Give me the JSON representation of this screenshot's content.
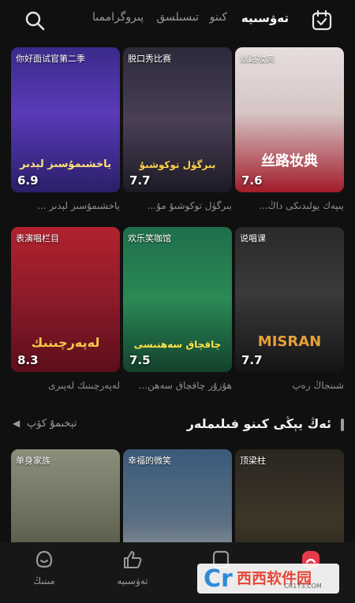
{
  "header": {
    "search_icon": "search-icon",
    "calendar_icon": "calendar-check-icon",
    "tabs": [
      {
        "label": "تەۋسىيە",
        "active": true
      },
      {
        "label": "كىنو",
        "active": false
      },
      {
        "label": "تىسىلسق",
        "active": false
      },
      {
        "label": "پىروگراممىا",
        "active": false
      }
    ]
  },
  "cards": [
    {
      "title": "你好面试官第二季",
      "score": "6.9",
      "caption": "ياخشىمۇسىز لېدىر ...",
      "art": "ياخشىمۇسىز لېدىر"
    },
    {
      "title": "脱口秀比赛",
      "score": "7.7",
      "caption": "بىرگۈل توكوشىۇ مۇ...",
      "art": "بىرگۈل توكوشىۇ"
    },
    {
      "title": "丝路妆典",
      "score": "7.6",
      "caption": "يىپەك يولىدىكى داڭ...",
      "art": "丝路妆典"
    },
    {
      "title": "表演唱栏目",
      "score": "8.3",
      "caption": "لەپەرچىنىك لەپىرى",
      "art": "لەپەرچىنىك"
    },
    {
      "title": "欢乐笑咖馆",
      "score": "7.5",
      "caption": "ھۇزۇر چاقچاق سەھن...",
      "art": "چاقچاق سەھنىسى"
    },
    {
      "title": "说唱课",
      "score": "7.7",
      "caption": "شىنجاڭ رەپ",
      "art": "MISRAN"
    },
    {
      "title": "单身家族",
      "score": "",
      "caption": "",
      "art": ""
    },
    {
      "title": "幸福的微笑",
      "score": "",
      "caption": "",
      "art": ""
    },
    {
      "title": "顶梁柱",
      "score": "",
      "caption": "",
      "art": ""
    }
  ],
  "section": {
    "title": "ئەڭ يېڭى كىنو فىلىملەر",
    "more": "تېخىمۇ كۆپ"
  },
  "bottom_nav": [
    {
      "label": "مىنىڭ",
      "icon": "smile-face-icon"
    },
    {
      "label": "تەۋسىيە",
      "icon": "thumbs-up-icon"
    },
    {
      "label": "",
      "icon": "video-icon"
    },
    {
      "label": "",
      "icon": "home-icon"
    }
  ],
  "watermark": {
    "main": "西西软件园",
    "sub": "CR173.COM",
    "c": "Cr"
  },
  "colors": {
    "background": "#101010",
    "nav": "#171717",
    "accent": "#e83a4d"
  }
}
